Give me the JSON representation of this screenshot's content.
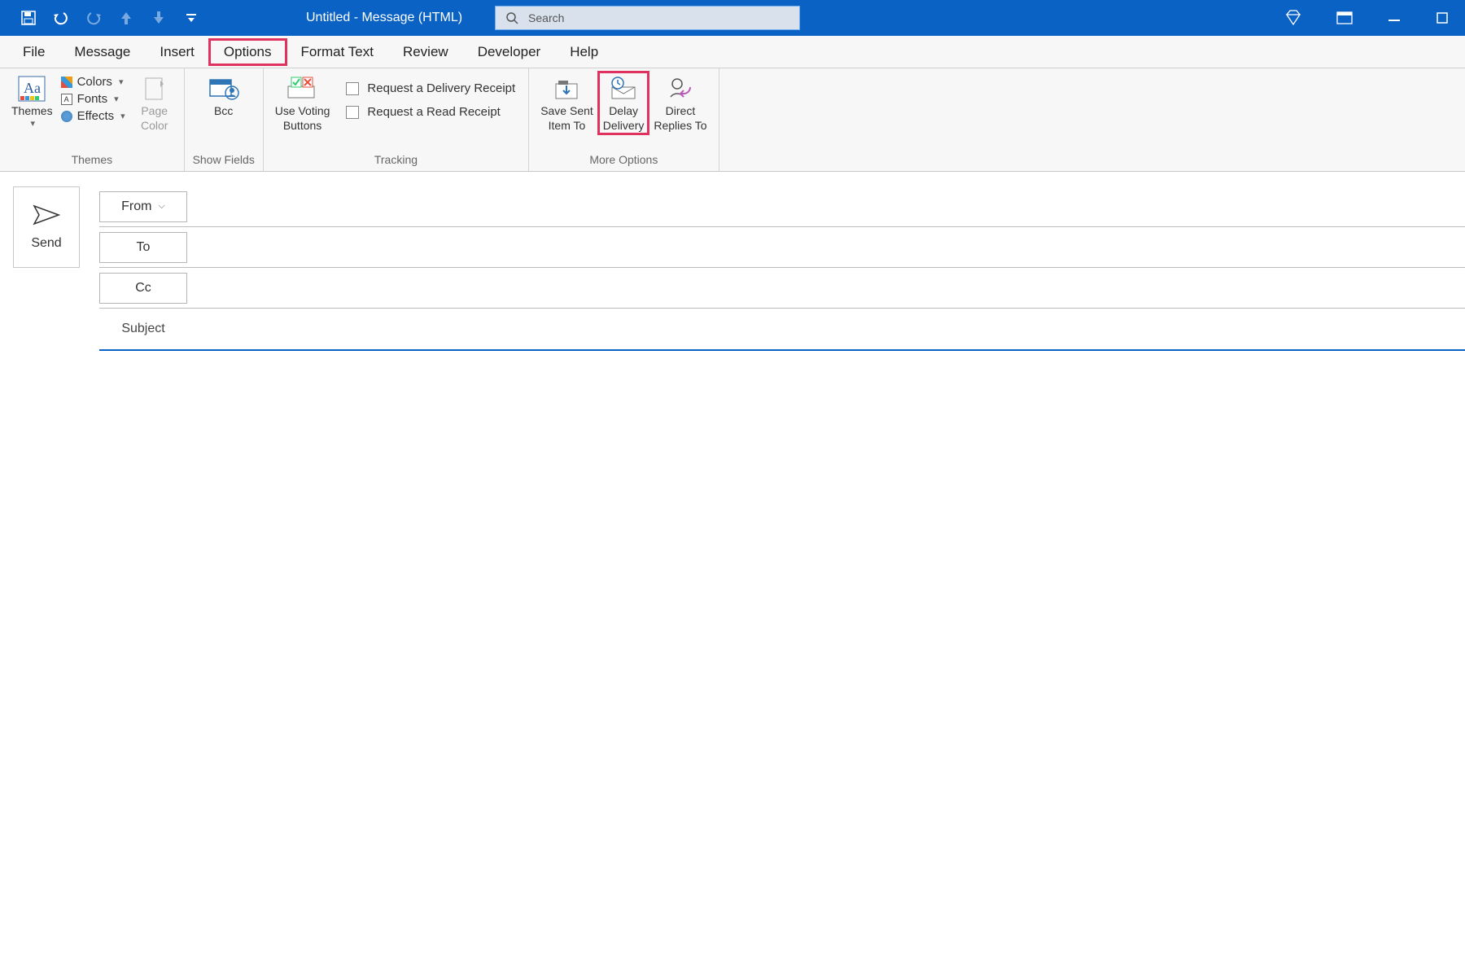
{
  "title": "Untitled  -  Message (HTML)",
  "search_placeholder": "Search",
  "tabs": {
    "file": "File",
    "message": "Message",
    "insert": "Insert",
    "options": "Options",
    "format_text": "Format Text",
    "review": "Review",
    "developer": "Developer",
    "help": "Help"
  },
  "ribbon": {
    "themes_group": "Themes",
    "themes_btn": "Themes",
    "colors": "Colors",
    "fonts": "Fonts",
    "effects": "Effects",
    "page_color": "Page\nColor",
    "showfields_group": "Show Fields",
    "bcc": "Bcc",
    "tracking_group": "Tracking",
    "voting": "Use Voting\nButtons",
    "delivery_receipt": "Request a Delivery Receipt",
    "read_receipt": "Request a Read Receipt",
    "moreoptions_group": "More Options",
    "save_sent": "Save Sent\nItem To",
    "delay_delivery": "Delay\nDelivery",
    "direct_replies": "Direct\nReplies To"
  },
  "compose": {
    "send": "Send",
    "from": "From",
    "to": "To",
    "cc": "Cc",
    "subject": "Subject"
  }
}
